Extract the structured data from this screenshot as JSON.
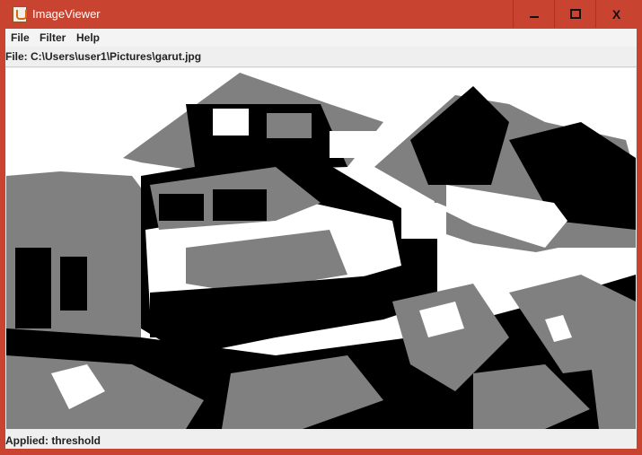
{
  "window": {
    "title": "ImageViewer",
    "accent_color": "#c94331",
    "controls": [
      "minimize-icon",
      "maximize-icon",
      "close-icon"
    ],
    "close_glyph": "X"
  },
  "menubar": {
    "items": [
      {
        "label": "File"
      },
      {
        "label": "Filter"
      },
      {
        "label": "Help"
      }
    ]
  },
  "file_path": "File: C:\\Users\\user1\\Pictures\\garut.jpg",
  "image": {
    "description": "threshold-filtered photo",
    "colors": [
      "#000000",
      "#808080",
      "#ffffff"
    ]
  },
  "status": "Applied: threshold"
}
